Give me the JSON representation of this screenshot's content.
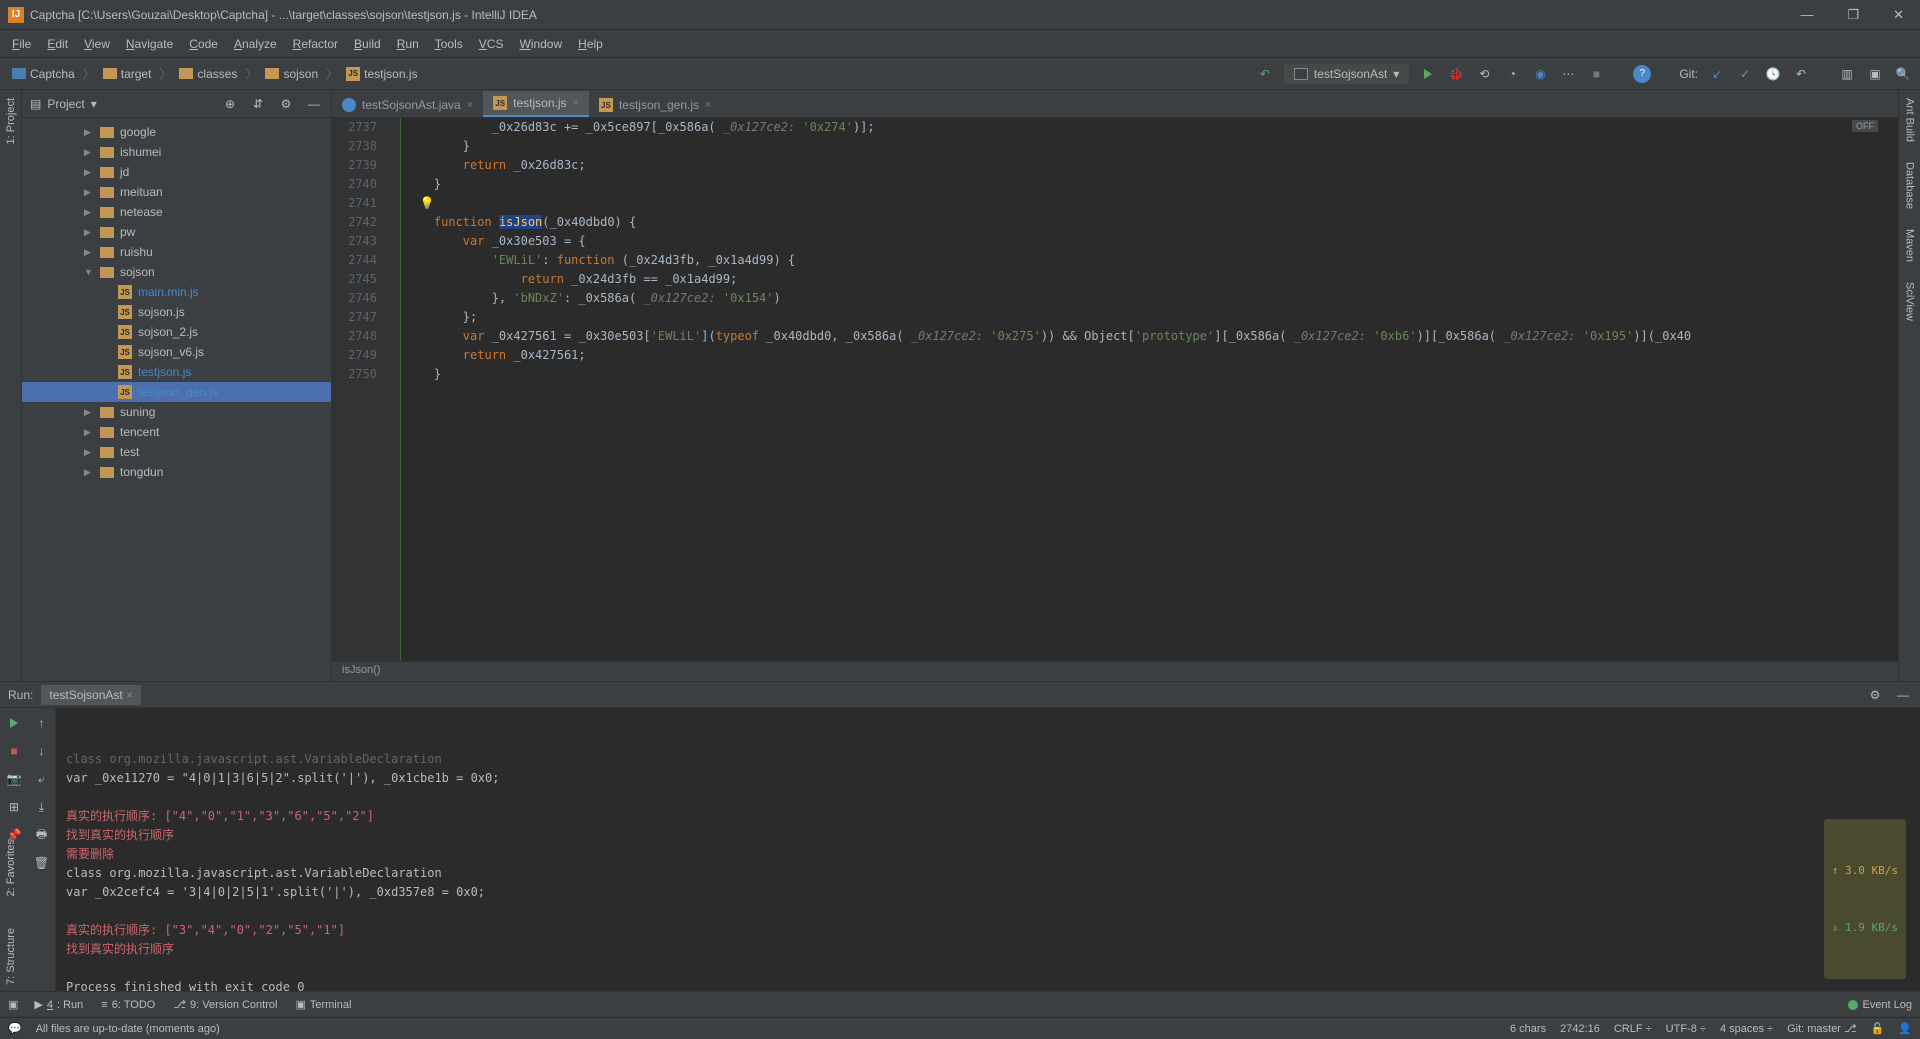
{
  "titlebar": {
    "app_icon_text": "IJ",
    "title": "Captcha [C:\\Users\\Gouzai\\Desktop\\Captcha] - ...\\target\\classes\\sojson\\testjson.js - IntelliJ IDEA",
    "minimize": "—",
    "maximize": "❐",
    "close": "✕"
  },
  "menubar": {
    "items": [
      "File",
      "Edit",
      "View",
      "Navigate",
      "Code",
      "Analyze",
      "Refactor",
      "Build",
      "Run",
      "Tools",
      "VCS",
      "Window",
      "Help"
    ]
  },
  "breadcrumbs": {
    "items": [
      {
        "icon": "folder-blue",
        "label": "Captcha"
      },
      {
        "icon": "folder",
        "label": "target"
      },
      {
        "icon": "folder",
        "label": "classes"
      },
      {
        "icon": "folder",
        "label": "sojson"
      },
      {
        "icon": "js",
        "label": "testjson.js"
      }
    ]
  },
  "run_config": {
    "label": "testSojsonAst"
  },
  "git_label": "Git:",
  "project": {
    "header": "Project",
    "tree": [
      {
        "indent": 3,
        "arrow": "▶",
        "icon": "folder",
        "label": "google"
      },
      {
        "indent": 3,
        "arrow": "▶",
        "icon": "folder",
        "label": "ishumei"
      },
      {
        "indent": 3,
        "arrow": "▶",
        "icon": "folder",
        "label": "jd"
      },
      {
        "indent": 3,
        "arrow": "▶",
        "icon": "folder",
        "label": "meituan"
      },
      {
        "indent": 3,
        "arrow": "▶",
        "icon": "folder",
        "label": "netease"
      },
      {
        "indent": 3,
        "arrow": "▶",
        "icon": "folder",
        "label": "pw"
      },
      {
        "indent": 3,
        "arrow": "▶",
        "icon": "folder",
        "label": "ruishu"
      },
      {
        "indent": 3,
        "arrow": "▼",
        "icon": "folder",
        "label": "sojson"
      },
      {
        "indent": 4,
        "arrow": "",
        "icon": "js",
        "label": "main.min.js",
        "highlight": true
      },
      {
        "indent": 4,
        "arrow": "",
        "icon": "js",
        "label": "sojson.js"
      },
      {
        "indent": 4,
        "arrow": "",
        "icon": "js",
        "label": "sojson_2.js"
      },
      {
        "indent": 4,
        "arrow": "",
        "icon": "js",
        "label": "sojson_v6.js"
      },
      {
        "indent": 4,
        "arrow": "",
        "icon": "js",
        "label": "testjson.js",
        "highlight": true
      },
      {
        "indent": 4,
        "arrow": "",
        "icon": "js",
        "label": "testjson_gen.js",
        "selected": true,
        "highlight": true
      },
      {
        "indent": 3,
        "arrow": "▶",
        "icon": "folder",
        "label": "suning"
      },
      {
        "indent": 3,
        "arrow": "▶",
        "icon": "folder",
        "label": "tencent"
      },
      {
        "indent": 3,
        "arrow": "▶",
        "icon": "folder",
        "label": "test"
      },
      {
        "indent": 3,
        "arrow": "▶",
        "icon": "folder",
        "label": "tongdun"
      }
    ]
  },
  "lsidebar": {
    "items": [
      "1: Project"
    ]
  },
  "lsidebar_bottom": {
    "items": [
      "2: Favorites",
      "7: Structure"
    ]
  },
  "rsidebar": {
    "items": [
      "Ant Build",
      "Database",
      "Maven",
      "SciView"
    ]
  },
  "tabs": [
    {
      "icon": "java",
      "label": "testSojsonAst.java",
      "active": false
    },
    {
      "icon": "js",
      "label": "testjson.js",
      "active": true
    },
    {
      "icon": "js",
      "label": "testjson_gen.js",
      "active": false
    }
  ],
  "editor": {
    "off_badge": "OFF",
    "line_start": 2737,
    "breadcrumb_bottom": "isJson()",
    "lines": [
      {
        "n": 2737,
        "html": "            _0x26d83c += _0x5ce897[_0x586a( <span class='hint'>_0x127ce2:</span> <span class='str'>'0x274'</span>)];"
      },
      {
        "n": 2738,
        "html": "        }"
      },
      {
        "n": 2739,
        "html": "        <span class='kw'>return</span> _0x26d83c;"
      },
      {
        "n": 2740,
        "html": "    }"
      },
      {
        "n": 2741,
        "html": "  <span class='bulb'>💡</span>"
      },
      {
        "n": 2742,
        "html": "    <span class='kw'>function</span> <span class='fnname sel'>isJson</span>(_0x40dbd0) {"
      },
      {
        "n": 2743,
        "html": "        <span class='kw'>var</span> _0x30e503 = {"
      },
      {
        "n": 2744,
        "html": "            <span class='str'>'EWLiL'</span>: <span class='kw'>function</span> (_0x24d3fb, _0x1a4d99) {"
      },
      {
        "n": 2745,
        "html": "                <span class='kw'>return</span> _0x24d3fb == _0x1a4d99;"
      },
      {
        "n": 2746,
        "html": "            }, <span class='str'>'bNDxZ'</span>: _0x586a( <span class='hint'>_0x127ce2:</span> <span class='str'>'0x154'</span>)"
      },
      {
        "n": 2747,
        "html": "        };"
      },
      {
        "n": 2748,
        "html": "        <span class='kw'>var</span> _0x427561 = _0x30e503[<span class='str'>'EWLiL'</span>](<span class='kw'>typeof</span> _0x40dbd0, _0x586a( <span class='hint'>_0x127ce2:</span> <span class='str'>'0x275'</span>)) && Object[<span class='str'>'prototype'</span>][_0x586a( <span class='hint'>_0x127ce2:</span> <span class='str'>'0xb6'</span>)][_0x586a( <span class='hint'>_0x127ce2:</span> <span class='str'>'0x195'</span>)](_0x40"
      },
      {
        "n": 2749,
        "html": "        <span class='kw'>return</span> _0x427561;"
      },
      {
        "n": 2750,
        "html": "    }"
      }
    ]
  },
  "run_panel": {
    "title": "Run:",
    "tab": "testSojsonAst",
    "console_lines": [
      {
        "cls": "",
        "text": "class org.mozilla.javascript.ast.VariableDeclaration",
        "dim": true
      },
      {
        "cls": "",
        "text": "var _0xe11270 = \"4|0|1|3|6|5|2\".split('|'), _0x1cbe1b = 0x0;"
      },
      {
        "cls": "",
        "text": ""
      },
      {
        "cls": "red",
        "text": "真实的执行顺序: [\"4\",\"0\",\"1\",\"3\",\"6\",\"5\",\"2\"]"
      },
      {
        "cls": "red",
        "text": "找到真实的执行顺序"
      },
      {
        "cls": "red",
        "text": "需要删除"
      },
      {
        "cls": "",
        "text": "class org.mozilla.javascript.ast.VariableDeclaration"
      },
      {
        "cls": "",
        "text": "var _0x2cefc4 = '3|4|0|2|5|1'.split('|'), _0xd357e8 = 0x0;"
      },
      {
        "cls": "",
        "text": ""
      },
      {
        "cls": "red",
        "text": "真实的执行顺序: [\"3\",\"4\",\"0\",\"2\",\"5\",\"1\"]"
      },
      {
        "cls": "red",
        "text": "找到真实的执行顺序"
      },
      {
        "cls": "",
        "text": ""
      },
      {
        "cls": "",
        "text": "Process finished with exit code 0"
      }
    ],
    "speed_up": "↑ 3.0 KB/s",
    "speed_down": "↓ 1.9 KB/s"
  },
  "bottombar": {
    "items": [
      {
        "icon": "▶",
        "label": "4: Run",
        "underline": true
      },
      {
        "icon": "≡",
        "label": "6: TODO"
      },
      {
        "icon": "⎇",
        "label": "9: Version Control"
      },
      {
        "icon": "▣",
        "label": "Terminal"
      }
    ],
    "event_log": "Event Log"
  },
  "statusbar": {
    "message": "All files are up-to-date (moments ago)",
    "chars": "6 chars",
    "pos": "2742:16",
    "eol": "CRLF",
    "enc": "UTF-8",
    "indent": "4 spaces",
    "git": "Git: master"
  }
}
